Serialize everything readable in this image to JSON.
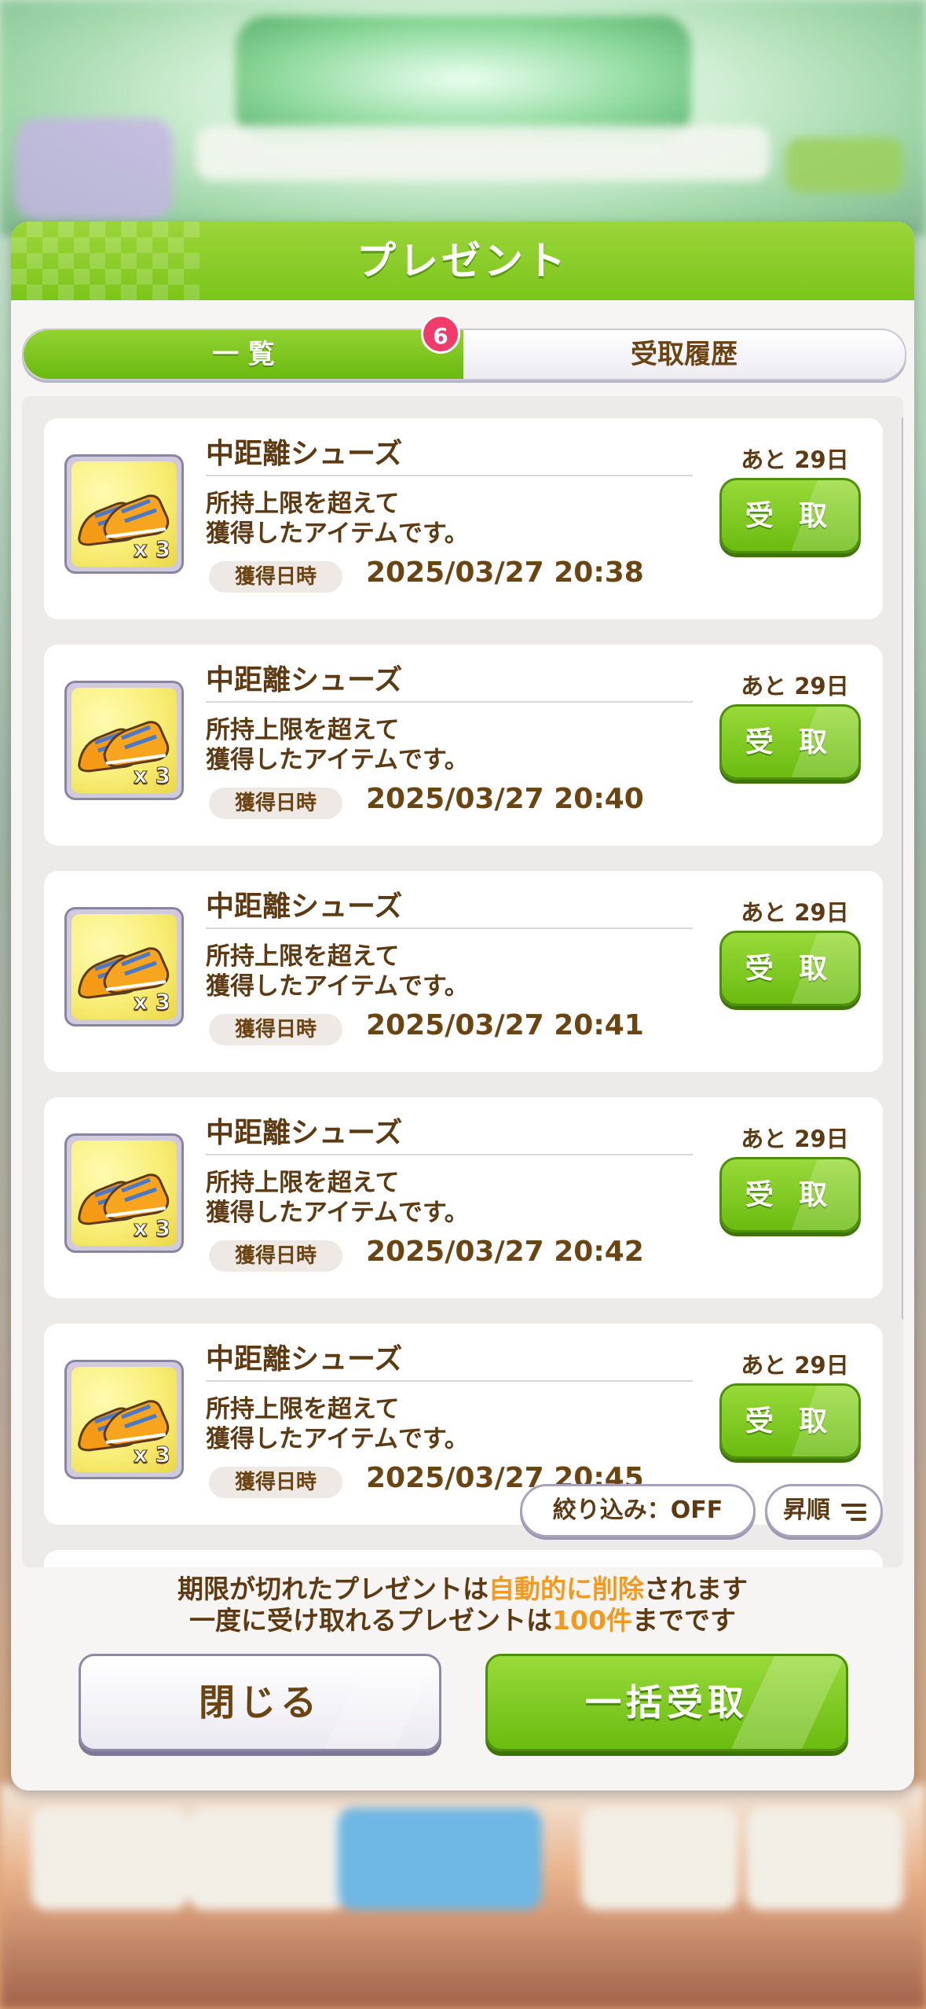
{
  "dialog": {
    "title": "プレゼント",
    "tabs": [
      {
        "label": "一 覧",
        "active": true
      },
      {
        "label": "受取履歴",
        "active": false
      }
    ],
    "badge_count": "6"
  },
  "items": [
    {
      "name": "中距離シューズ",
      "desc_line1": "所持上限を超えて",
      "desc_line2": "獲得したアイテムです。",
      "date_label": "獲得日時",
      "date": "2025/03/27 20:38",
      "remaining": "あと 29日",
      "quantity": "x 3",
      "button": "受 取",
      "icon": "running-shoes-icon"
    },
    {
      "name": "中距離シューズ",
      "desc_line1": "所持上限を超えて",
      "desc_line2": "獲得したアイテムです。",
      "date_label": "獲得日時",
      "date": "2025/03/27 20:40",
      "remaining": "あと 29日",
      "quantity": "x 3",
      "button": "受 取",
      "icon": "running-shoes-icon"
    },
    {
      "name": "中距離シューズ",
      "desc_line1": "所持上限を超えて",
      "desc_line2": "獲得したアイテムです。",
      "date_label": "獲得日時",
      "date": "2025/03/27 20:41",
      "remaining": "あと 29日",
      "quantity": "x 3",
      "button": "受 取",
      "icon": "running-shoes-icon"
    },
    {
      "name": "中距離シューズ",
      "desc_line1": "所持上限を超えて",
      "desc_line2": "獲得したアイテムです。",
      "date_label": "獲得日時",
      "date": "2025/03/27 20:42",
      "remaining": "あと 29日",
      "quantity": "x 3",
      "button": "受 取",
      "icon": "running-shoes-icon"
    },
    {
      "name": "中距離シューズ",
      "desc_line1": "所持上限を超えて",
      "desc_line2": "獲得したアイテムです。",
      "date_label": "獲得日時",
      "date": "2025/03/27 20:45",
      "remaining": "あと 29日",
      "quantity": "x 3",
      "button": "受 取",
      "icon": "running-shoes-icon"
    }
  ],
  "controls": {
    "filter_label": "絞り込み：OFF",
    "sort_label": "昇順",
    "sort_icon": "sort-lines-icon"
  },
  "notice": {
    "line1_a": "期限が切れたプレゼントは",
    "line1_hl": "自動的に削除",
    "line1_b": "されます",
    "line2_a": "一度に受け取れるプレゼントは",
    "line2_hl": "100件",
    "line2_b": "までです"
  },
  "footer": {
    "close_label": "閉じる",
    "receive_all_label": "一括受取"
  },
  "colors": {
    "accent_green": "#7cc51b",
    "text_brown": "#5e3a12",
    "highlight_orange": "#f39a1e",
    "badge_pink": "#ef3c6b"
  }
}
